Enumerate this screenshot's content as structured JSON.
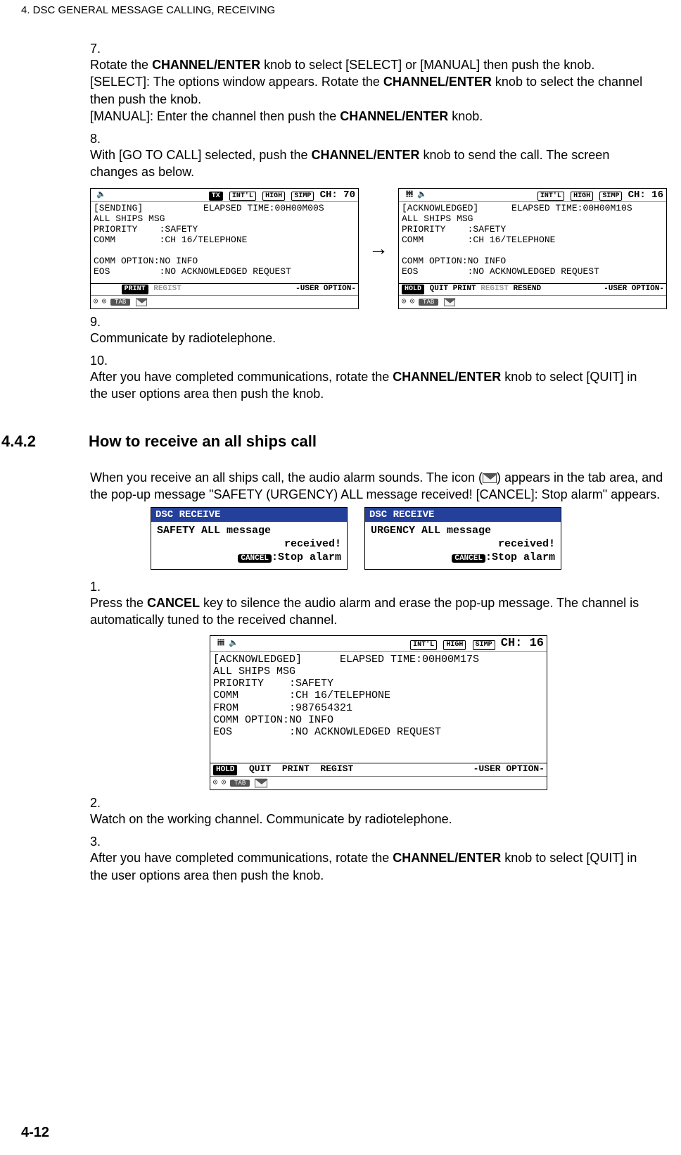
{
  "chapter_header": "4.  DSC GENERAL MESSAGE CALLING, RECEIVING",
  "steps_a": {
    "n7": "7.",
    "t7a": "Rotate the ",
    "t7b": " knob to select [SELECT] or [MANUAL] then push the knob.",
    "t7c": "[SELECT]: The options window appears. Rotate the ",
    "t7d": " knob to select the channel then push the knob.",
    "t7e": "[MANUAL]: Enter the channel then push the ",
    "t7f": " knob.",
    "n8": "8.",
    "t8a": "With [GO TO CALL] selected, push the ",
    "t8b": " knob to send the call. The screen changes as below.",
    "n9": "9.",
    "t9": "Communicate by radiotelephone.",
    "n10": "10.",
    "t10a": "After you have completed communications, rotate the ",
    "t10b": " knob to select [QUIT] in the user options area then push the knob."
  },
  "knob": "CHANNEL/ENTER",
  "sect": {
    "num": "4.4.2",
    "title": "How to receive an all ships call"
  },
  "intro": {
    "a": "When you receive an all ships call, the audio alarm sounds. The icon (",
    "b": ") appears in the tab area, and the pop-up message \"SAFETY (URGENCY) ALL message received! [CANCEL]: Stop alarm\" appears."
  },
  "steps_b": {
    "n1": "1.",
    "t1a": "Press the ",
    "t1b": " key to silence the audio alarm and erase the pop-up message. The channel is automatically tuned to the received channel.",
    "cancel": "CANCEL",
    "n2": "2.",
    "t2": "Watch on the working channel. Communicate by radiotelephone.",
    "n3": "3.",
    "t3a": "After you have completed communications, rotate the ",
    "t3b": " knob to select [QUIT] in the user options area then push the knob."
  },
  "scr1": {
    "pills": {
      "tx": "TX",
      "intl": "INT'L",
      "high": "HIGH",
      "simp": "SIMP"
    },
    "ch": "CH: 70",
    "l1": "[SENDING]           ELAPSED TIME:00H00M00S",
    "l2": "ALL SHIPS MSG",
    "l3": "PRIORITY    :SAFETY",
    "l4": "COMM        :CH 16/TELEPHONE",
    "l5": "COMM OPTION:NO INFO",
    "l6": "EOS         :NO ACKNOWLEDGED REQUEST",
    "foot_left": "        PRINT  REGIST",
    "foot_right": "-USER OPTION-"
  },
  "scr2": {
    "pills": {
      "intl": "INT'L",
      "high": "HIGH",
      "simp": "SIMP"
    },
    "ch": "CH: 16",
    "l1": "[ACKNOWLEDGED]      ELAPSED TIME:00H00M10S",
    "l2": "ALL SHIPS MSG",
    "l3": "PRIORITY    :SAFETY",
    "l4": "COMM        :CH 16/TELEPHONE",
    "l5": "COMM OPTION:NO INFO",
    "l6": "EOS         :NO ACKNOWLEDGED REQUEST",
    "foot_left": "HOLD  QUIT  PRINT  REGIST  RESEND",
    "foot_right": "-USER OPTION-"
  },
  "pop1": {
    "hdr": "DSC RECEIVE",
    "l1": "SAFETY ALL message",
    "l2": "received!",
    "l3": ":Stop alarm",
    "cancel": "CANCEL"
  },
  "pop2": {
    "hdr": "DSC RECEIVE",
    "l1": "URGENCY ALL message",
    "l2": "received!",
    "l3": ":Stop alarm",
    "cancel": "CANCEL"
  },
  "scr3": {
    "pills": {
      "intl": "INT'L",
      "high": "HIGH",
      "simp": "SIMP"
    },
    "ch": "CH: 16",
    "l1": "[ACKNOWLEDGED]      ELAPSED TIME:00H00M17S",
    "l2": "ALL SHIPS MSG",
    "l3": "PRIORITY    :SAFETY",
    "l4": "COMM        :CH 16/TELEPHONE",
    "l5": "FROM        :987654321",
    "l6": "COMM OPTION:NO INFO",
    "l7": "EOS         :NO ACKNOWLEDGED REQUEST",
    "foot_left": "HOLD  QUIT  PRINT  REGIST",
    "foot_right": "-USER OPTION-"
  },
  "tab_label": "TAB",
  "page_num": "4-12"
}
